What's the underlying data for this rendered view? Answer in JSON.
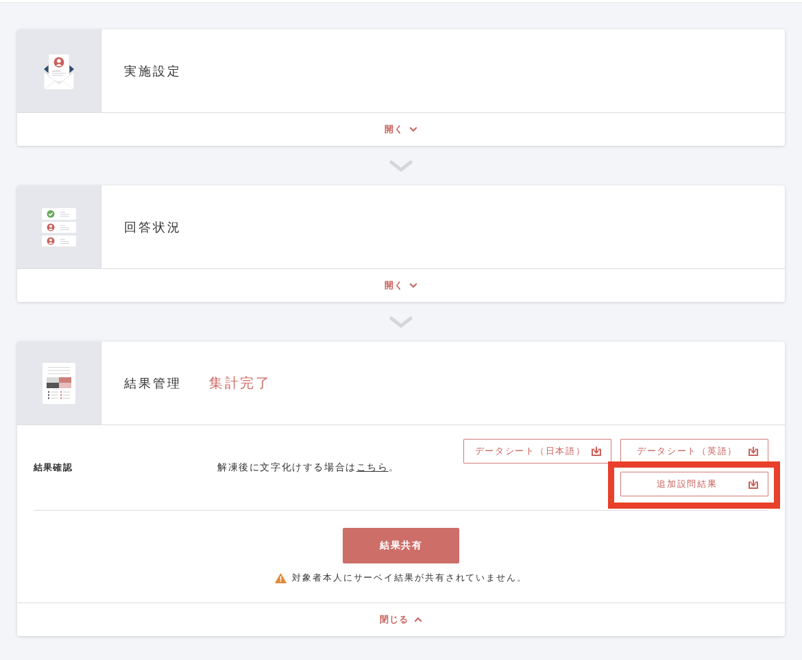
{
  "sections": [
    {
      "kind": "settings",
      "title": "実施設定",
      "expanded": false,
      "toggle": "開く"
    },
    {
      "kind": "responses",
      "title": "回答状況",
      "expanded": false,
      "toggle": "開く"
    },
    {
      "kind": "results",
      "title": "結果管理",
      "status": "集計完了",
      "expanded": true,
      "toggle": "閉じる",
      "body": {
        "label": "結果確認",
        "note": {
          "text": "解凍後に文字化けする場合は",
          "link": "こちら",
          "after": "。"
        },
        "downloads": [
          {
            "label": "データシート（日本語）",
            "highlighted": false
          },
          {
            "label": "データシート（英語）",
            "highlighted": false
          },
          {
            "label": "追加設問結果",
            "highlighted": true
          }
        ],
        "share_button": "結果共有",
        "warning": "対象者本人にサーベイ結果が共有されていません。"
      }
    }
  ]
}
